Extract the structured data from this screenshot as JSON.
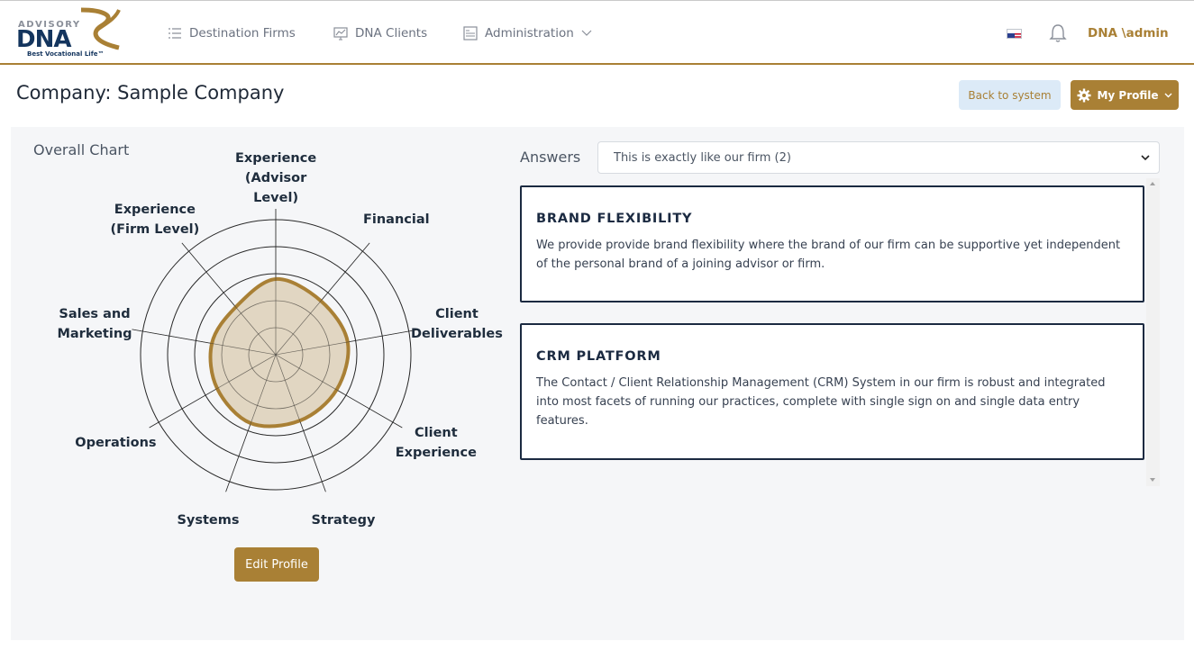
{
  "brand": {
    "logo_top": "ADVISORY",
    "logo_main": "DNA",
    "tagline": "Best Vocational Life™",
    "accent": "#a98035",
    "navy": "#14355e"
  },
  "nav": {
    "items": [
      {
        "label": "Destination Firms",
        "icon": "list-icon"
      },
      {
        "label": "DNA Clients",
        "icon": "chart-monitor-icon"
      },
      {
        "label": "Administration",
        "icon": "admin-panel-icon"
      }
    ],
    "user": "DNA \\admin",
    "flag": "us-flag-icon"
  },
  "page": {
    "title": "Company: Sample Company",
    "back_label": "Back to system",
    "profile_label": "My Profile"
  },
  "chart_section": {
    "title": "Overall Chart",
    "edit_label": "Edit Profile"
  },
  "chart_data": {
    "type": "radar",
    "axes": [
      "Experience (Advisor Level)",
      "Financial",
      "Client Deliverables",
      "Client Experience",
      "Strategy",
      "Systems",
      "Operations",
      "Sales and Marketing",
      "Experience (Firm Level)"
    ],
    "axis_label_lines": [
      [
        "Experience",
        "(Advisor",
        "Level)"
      ],
      [
        "Financial"
      ],
      [
        "Client",
        "Deliverables"
      ],
      [
        "Client",
        "Experience"
      ],
      [
        "Strategy"
      ],
      [
        "Systems"
      ],
      [
        "Operations"
      ],
      [
        "Sales and",
        "Marketing"
      ],
      [
        "Experience",
        "(Firm Level)"
      ]
    ],
    "rings": 5,
    "range": [
      0,
      5
    ],
    "values": [
      2.8,
      2.6,
      2.7,
      2.6,
      2.6,
      2.7,
      2.5,
      2.4,
      2.3
    ],
    "fill": "#ddd0b9",
    "stroke": "#a98035"
  },
  "answers": {
    "label": "Answers",
    "selected": "This is exactly like our firm (2)",
    "cards": [
      {
        "title": "BRAND FLEXIBILITY",
        "text": "We provide provide brand flexibility where the brand of our firm can be supportive yet independent of the personal brand of a joining advisor or firm."
      },
      {
        "title": "CRM PLATFORM",
        "text": "The Contact / Client Relationship Management (CRM) System in our firm is robust and integrated into most facets of running our practices, complete with single sign on and single data entry features."
      }
    ]
  }
}
